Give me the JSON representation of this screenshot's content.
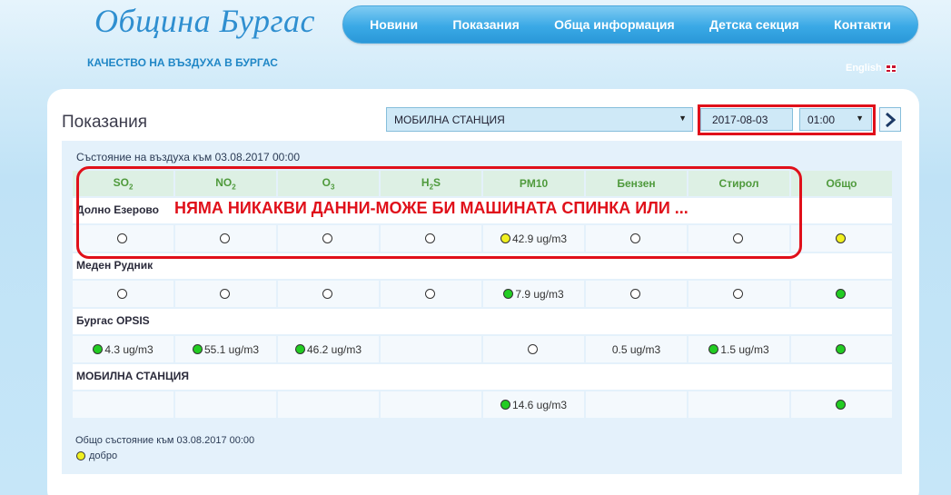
{
  "header": {
    "logo_text": "Община Бургас",
    "subtitle": "КАЧЕСТВО НА ВЪЗДУХА В БУРГАС",
    "nav": [
      "Новини",
      "Показания",
      "Обща информация",
      "Детска секция",
      "Контакти"
    ],
    "language_link": "English"
  },
  "main": {
    "title": "Показания",
    "station_select": "МОБИЛНА СТАНЦИЯ",
    "date": "2017-08-03",
    "time": "01:00",
    "state_title": "Състояние на въздуха към 03.08.2017 00:00",
    "columns": [
      {
        "base": "SO",
        "sub": "2"
      },
      {
        "base": "NO",
        "sub": "2"
      },
      {
        "base": "O",
        "sub": "3"
      },
      {
        "base": "H",
        "sub": "2",
        "tail": "S"
      },
      {
        "base": "PM10"
      },
      {
        "base": "Бензен"
      },
      {
        "base": "Стирол"
      },
      {
        "base": "Общо"
      }
    ],
    "stations": [
      {
        "name": "Долно Езерово",
        "cells": [
          {
            "status": "empty",
            "value": ""
          },
          {
            "status": "empty",
            "value": ""
          },
          {
            "status": "empty",
            "value": ""
          },
          {
            "status": "empty",
            "value": ""
          },
          {
            "status": "yellow",
            "value": "42.9 ug/m3"
          },
          {
            "status": "empty",
            "value": ""
          },
          {
            "status": "empty",
            "value": ""
          },
          {
            "status": "yellow",
            "value": ""
          }
        ]
      },
      {
        "name": "Меден Рудник",
        "cells": [
          {
            "status": "empty",
            "value": ""
          },
          {
            "status": "empty",
            "value": ""
          },
          {
            "status": "empty",
            "value": ""
          },
          {
            "status": "empty",
            "value": ""
          },
          {
            "status": "green",
            "value": "7.9 ug/m3"
          },
          {
            "status": "empty",
            "value": ""
          },
          {
            "status": "empty",
            "value": ""
          },
          {
            "status": "green",
            "value": ""
          }
        ]
      },
      {
        "name": "Бургас OPSIS",
        "cells": [
          {
            "status": "green",
            "value": "4.3 ug/m3"
          },
          {
            "status": "green",
            "value": "55.1 ug/m3"
          },
          {
            "status": "green",
            "value": "46.2 ug/m3"
          },
          {
            "status": "none",
            "value": ""
          },
          {
            "status": "empty",
            "value": ""
          },
          {
            "status": "none",
            "value": "0.5 ug/m3"
          },
          {
            "status": "green",
            "value": "1.5 ug/m3"
          },
          {
            "status": "green",
            "value": ""
          }
        ]
      },
      {
        "name": "МОБИЛНА СТАНЦИЯ",
        "cells": [
          {
            "status": "none",
            "value": ""
          },
          {
            "status": "none",
            "value": ""
          },
          {
            "status": "none",
            "value": ""
          },
          {
            "status": "none",
            "value": ""
          },
          {
            "status": "green",
            "value": "14.6 ug/m3"
          },
          {
            "status": "none",
            "value": ""
          },
          {
            "status": "none",
            "value": ""
          },
          {
            "status": "green",
            "value": ""
          }
        ]
      }
    ],
    "overall_state": "Общо състояние към 03.08.2017 00:00",
    "overall_label": "добро",
    "overall_status": "yellow",
    "annotation": "НЯМА НИКАКВИ ДАННИ-МОЖЕ БИ МАШИНАТА СПИНКА ИЛИ ..."
  },
  "colors": {
    "good": "#22cc22",
    "moderate": "#f0f020",
    "highlight": "#e0101a",
    "header_text": "#4f9a3c"
  }
}
